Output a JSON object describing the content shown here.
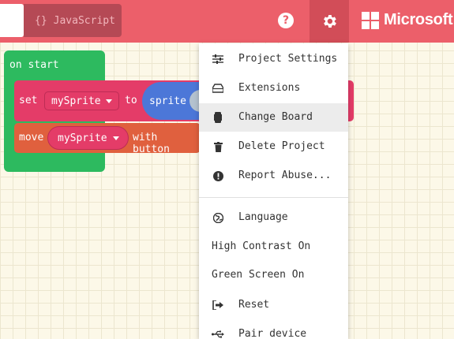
{
  "toolbar": {
    "javascript_label": "JavaScript",
    "braces": "{}",
    "help_symbol": "?",
    "brand_name": "Microsoft"
  },
  "blocks": {
    "on_start": "on start",
    "set_kw": "set",
    "set_var": "mySprite",
    "to_kw": "to",
    "sprite_kw": "sprite",
    "move_kw": "move",
    "move_var": "mySprite",
    "with_buttons_kw": "with button"
  },
  "menu": {
    "items": [
      {
        "label": "Project Settings",
        "icon": "sliders-icon"
      },
      {
        "label": "Extensions",
        "icon": "drive-icon"
      },
      {
        "label": "Change Board",
        "icon": "board-icon"
      },
      {
        "label": "Delete Project",
        "icon": "trash-icon"
      },
      {
        "label": "Report Abuse...",
        "icon": "alert-icon"
      },
      {
        "label": "Language",
        "icon": "globe-icon"
      },
      {
        "label": "High Contrast On",
        "icon": ""
      },
      {
        "label": "Green Screen On",
        "icon": ""
      },
      {
        "label": "Reset",
        "icon": "sign-out-icon"
      },
      {
        "label": "Pair device",
        "icon": "usb-icon"
      }
    ],
    "highlighted": "Change Board"
  },
  "colors": {
    "header": "#ec5f6a",
    "event_block": "#2dba5f",
    "sprite_block": "#e43c68",
    "controller_block": "#e0603e",
    "sprite_pill": "#4c77d8"
  }
}
